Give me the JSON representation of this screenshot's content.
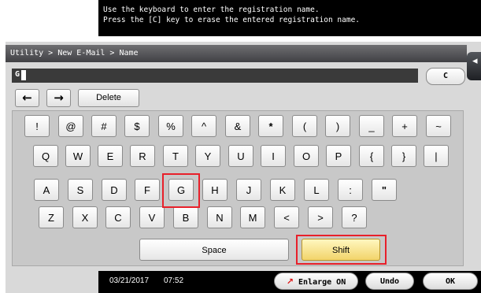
{
  "instructions": {
    "line1": "Use the keyboard to enter the registration name.",
    "line2": "Press the [C] key to erase the entered registration name."
  },
  "breadcrumb": "Utility > New E-Mail > Name",
  "input": {
    "value": "G"
  },
  "buttons": {
    "clear": "C",
    "left_arrow": "←",
    "right_arrow": "→",
    "delete": "Delete",
    "space": "Space",
    "shift": "Shift",
    "enlarge": "Enlarge ON",
    "undo": "Undo",
    "ok": "OK"
  },
  "keyboard": {
    "row1": [
      "!",
      "@",
      "#",
      "$",
      "%",
      "^",
      "&",
      "*",
      "(",
      ")",
      "_",
      "+",
      "~"
    ],
    "row2": [
      "Q",
      "W",
      "E",
      "R",
      "T",
      "Y",
      "U",
      "I",
      "O",
      "P",
      "{",
      "}",
      "|"
    ],
    "row3": [
      "A",
      "S",
      "D",
      "F",
      "G",
      "H",
      "J",
      "K",
      "L",
      ":",
      "\""
    ],
    "row4": [
      "Z",
      "X",
      "C",
      "V",
      "B",
      "N",
      "M",
      "<",
      ">",
      "?"
    ]
  },
  "status": {
    "date": "03/21/2017",
    "time": "07:52"
  },
  "colors": {
    "highlight": "#e8202a",
    "shift_key": "#f2d46a"
  }
}
